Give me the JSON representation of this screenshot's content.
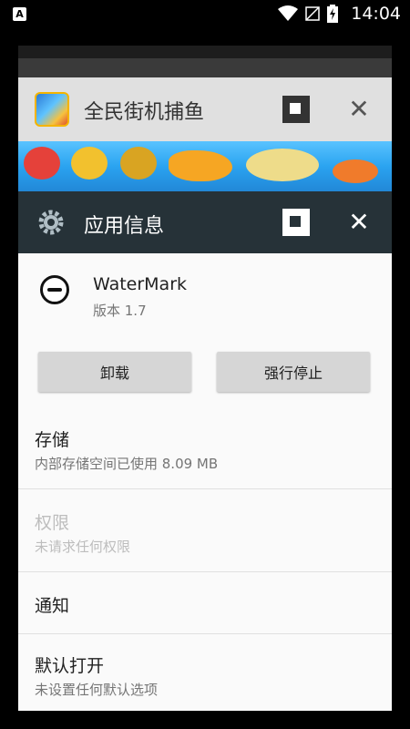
{
  "status_bar": {
    "time": "14:04",
    "app_icon_letter": "A",
    "icons": [
      "wifi-icon",
      "signal-off-icon",
      "battery-charging-icon"
    ]
  },
  "game_card": {
    "title": "全民街机捕鱼",
    "banner_labels": [
      "鱼"
    ]
  },
  "settings_card": {
    "title": "应用信息",
    "app": {
      "name": "WaterMark",
      "version": "版本 1.7"
    },
    "buttons": {
      "uninstall": "卸载",
      "force_stop": "强行停止"
    },
    "prefs": [
      {
        "title": "存储",
        "subtitle": "内部存储空间已使用 8.09 MB",
        "enabled": true
      },
      {
        "title": "权限",
        "subtitle": "未请求任何权限",
        "enabled": false
      },
      {
        "title": "通知",
        "subtitle": "",
        "enabled": true
      },
      {
        "title": "默认打开",
        "subtitle": "未设置任何默认选项",
        "enabled": true
      }
    ]
  },
  "colors": {
    "settings_header": "#263238",
    "game_header": "#e0e0e0",
    "button": "#d6d6d6"
  }
}
